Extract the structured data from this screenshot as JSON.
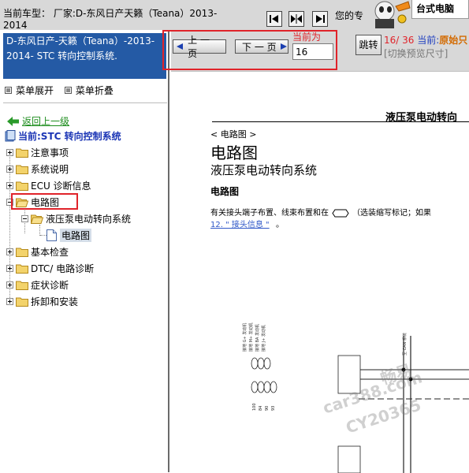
{
  "header": {
    "vehicle_info": "当前车型： 厂家:D-东风日产天籁（Teana）2013-2014",
    "nav_label": "您的专",
    "banner_text": "台式电脑"
  },
  "sidebar": {
    "title": "D-东风日产-天籁（Teana）-2013-2014- STC 转向控制系统.",
    "expand_label": "菜单展开",
    "collapse_label": "菜单折叠",
    "back_label": "返回上一级",
    "current_label": "当前:STC 转向控制系统",
    "tree": [
      {
        "label": "注意事项",
        "state": "plus"
      },
      {
        "label": "系统说明",
        "state": "plus"
      },
      {
        "label": "ECU 诊断信息",
        "state": "plus"
      },
      {
        "label": "电路图",
        "state": "minus",
        "highlighted": true
      },
      {
        "label": "液压泵电动转向系统",
        "state": "minus",
        "level": 2
      },
      {
        "label": "电路图",
        "state": "leaf",
        "level": 3,
        "selected": true
      },
      {
        "label": "基本检查",
        "state": "plus"
      },
      {
        "label": "DTC/ 电路诊断",
        "state": "plus"
      },
      {
        "label": "症状诊断",
        "state": "plus"
      },
      {
        "label": "拆卸和安装",
        "state": "plus"
      }
    ]
  },
  "pager": {
    "prev_label": "上 一 页",
    "next_label": "下 一 页",
    "current_label": "当前为",
    "page_value": "16",
    "jump_label": "跳转",
    "page_count": "16/ 36",
    "current_prefix": "当前:",
    "current_name": "原始只",
    "preview_size": "[切换预览尺寸]"
  },
  "document": {
    "page_title": "液压泵电动转向",
    "breadcrumb": "< 电路图 >",
    "h1": "电路图",
    "h2": "液压泵电动转向系统",
    "h3": "电路图",
    "para_before": "有关接头端子布置、线束布置和在",
    "para_after": "（选装缩写标记；如果",
    "link": "12. \" 接头信息 \"",
    "link_tail": "。"
  },
  "watermark": {
    "line1": "畅易",
    "line2": "car388.com",
    "line3": "CY20365"
  },
  "colors": {
    "accent_blue": "#245aa5",
    "highlight_red": "#e0232a",
    "link_green": "#1b8c1b",
    "link_blue": "#3058c8"
  }
}
